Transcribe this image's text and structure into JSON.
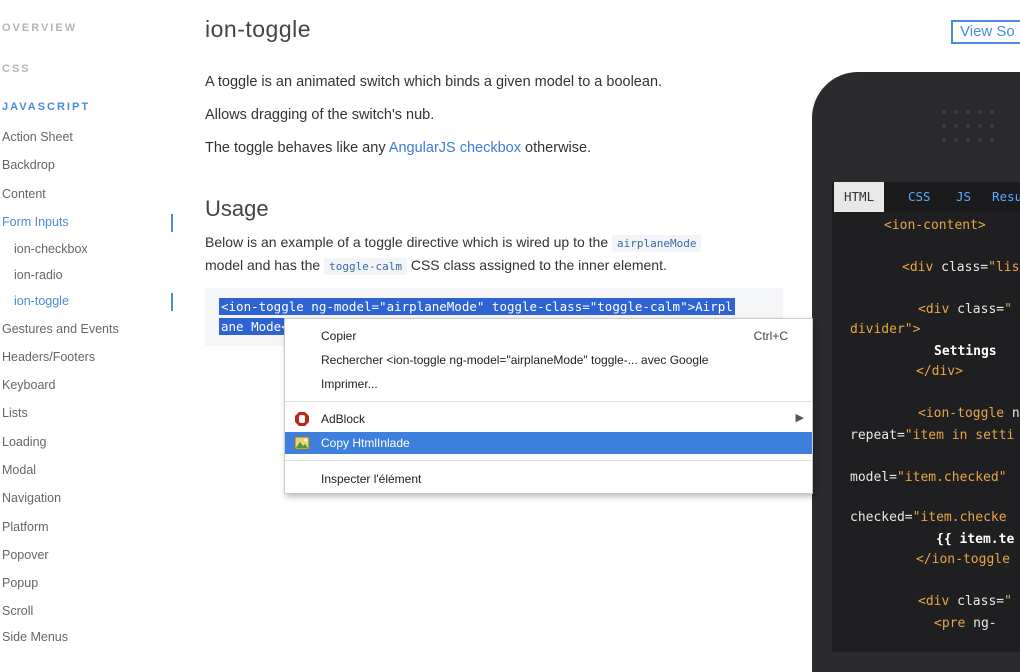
{
  "sidebar": {
    "sections": [
      "OVERVIEW",
      "CSS",
      "JAVASCRIPT"
    ],
    "items": [
      {
        "label": "Action Sheet"
      },
      {
        "label": "Backdrop"
      },
      {
        "label": "Content"
      },
      {
        "label": "Form Inputs"
      },
      {
        "label": "ion-checkbox"
      },
      {
        "label": "ion-radio"
      },
      {
        "label": "ion-toggle"
      },
      {
        "label": "Gestures and Events"
      },
      {
        "label": "Headers/Footers"
      },
      {
        "label": "Keyboard"
      },
      {
        "label": "Lists"
      },
      {
        "label": "Loading"
      },
      {
        "label": "Modal"
      },
      {
        "label": "Navigation"
      },
      {
        "label": "Platform"
      },
      {
        "label": "Popover"
      },
      {
        "label": "Popup"
      },
      {
        "label": "Scroll"
      },
      {
        "label": "Side Menus"
      }
    ]
  },
  "main": {
    "title": "ion-toggle",
    "p1": "A toggle is an animated switch which binds a given model to a boolean.",
    "p2": "Allows dragging of the switch's nub.",
    "p3_before": "The toggle behaves like any ",
    "p3_link": "AngularJS checkbox",
    "p3_after": " otherwise.",
    "usage_title": "Usage",
    "usage_p1_before": "Below is an example of a toggle directive which is wired up to the ",
    "usage_code1": "airplaneMode",
    "usage_p2_before": "model and has the ",
    "usage_code2": "toggle-calm",
    "usage_p2_after": " CSS class assigned to the inner element.",
    "code_line1": "<ion-toggle ng-model=\"airplaneMode\" toggle-class=\"toggle-calm\">Airpl",
    "code_line2": "ane Mode</"
  },
  "view_source_label": "View So",
  "phone": {
    "tabs": [
      "HTML",
      "CSS",
      "JS",
      "Resu"
    ],
    "code": [
      {
        "parts": [
          [
            "tag",
            "<ion-content>"
          ]
        ]
      },
      {
        "parts": [
          [
            "tag",
            "<div "
          ],
          [
            "attr",
            "class="
          ],
          [
            "str",
            "\"lis"
          ]
        ]
      },
      {
        "parts": [
          [
            "tag",
            "<div "
          ],
          [
            "attr",
            "class="
          ],
          [
            "str",
            "\""
          ]
        ]
      },
      {
        "parts": [
          [
            "str",
            "divider\">"
          ]
        ]
      },
      {
        "parts": [
          [
            "txt",
            "Settings"
          ]
        ]
      },
      {
        "parts": [
          [
            "tag",
            "</div>"
          ]
        ]
      },
      {
        "parts": [
          [
            "tag",
            "<ion-toggle "
          ],
          [
            "attr",
            "n"
          ]
        ]
      },
      {
        "parts": [
          [
            "attr",
            "repeat="
          ],
          [
            "str",
            "\"item in setti"
          ]
        ]
      },
      {
        "parts": [
          [
            "attr",
            "model="
          ],
          [
            "str",
            "\"item.checked\""
          ]
        ]
      },
      {
        "parts": [
          [
            "attr",
            "checked="
          ],
          [
            "str",
            "\"item.checke"
          ]
        ]
      },
      {
        "parts": [
          [
            "txt",
            "{{ item.te"
          ]
        ]
      },
      {
        "parts": [
          [
            "tag",
            "</ion-toggle"
          ]
        ]
      },
      {
        "parts": [
          [
            "tag",
            "<div "
          ],
          [
            "attr",
            "class="
          ],
          [
            "str",
            "\""
          ]
        ]
      },
      {
        "parts": [
          [
            "tag",
            "<pre "
          ],
          [
            "attr",
            "ng-"
          ]
        ]
      }
    ]
  },
  "context_menu": {
    "items": [
      {
        "label": "Copier",
        "shortcut": "Ctrl+C"
      },
      {
        "label": "Rechercher <ion-toggle ng-model=\"airplaneMode\" toggle-... avec Google"
      },
      {
        "label": "Imprimer..."
      },
      {
        "label": "AdBlock",
        "icon": "adblock-icon"
      },
      {
        "label": "Copy HtmlInlade",
        "icon": "image-icon"
      },
      {
        "label": "Inspecter l'élément"
      }
    ]
  },
  "colors": {
    "accent": "#4a8bdb",
    "highlight": "#3d7fdc",
    "phone_bg": "#2b2b2d"
  }
}
